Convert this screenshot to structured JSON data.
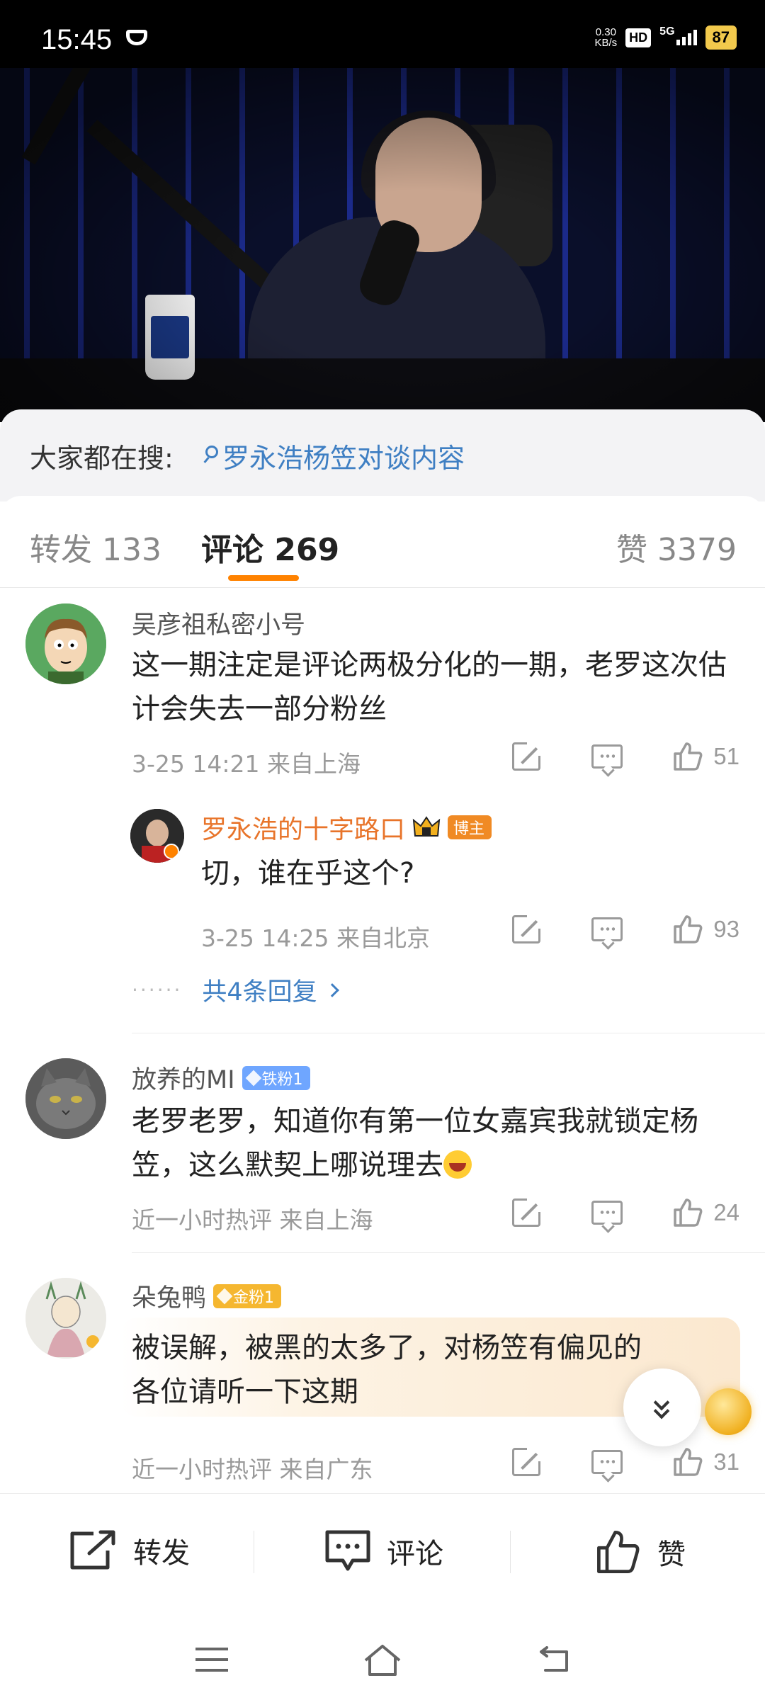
{
  "status_bar": {
    "time": "15:45",
    "net_speed_value": "0.30",
    "net_speed_unit": "KB/s",
    "hd": "HD",
    "network": "5G",
    "battery": "87"
  },
  "search_hint": {
    "label": "大家都在搜:",
    "query": "罗永浩杨笠对谈内容"
  },
  "tabs": {
    "repost_label": "转发",
    "repost_count": "133",
    "comment_label": "评论",
    "comment_count": "269",
    "like_label": "赞",
    "like_count": "3379"
  },
  "comments": [
    {
      "username": "吴彦祖私密小号",
      "text": "这一期注定是评论两极分化的一期，老罗这次估计会失去一部分粉丝",
      "meta": "3-25 14:21  来自上海",
      "likes": "51",
      "reply": {
        "username": "罗永浩的十字路口",
        "badge": "博主",
        "text": "切，谁在乎这个?",
        "meta": "3-25 14:25  来自北京",
        "likes": "93"
      },
      "more_replies": "共4条回复"
    },
    {
      "username": "放养的MI",
      "badge": "铁粉1",
      "text": "老罗老罗，知道你有第一位女嘉宾我就锁定杨笠，这么默契上哪说理去",
      "meta": "近一小时热评  来自上海",
      "likes": "24"
    },
    {
      "username": "朵兔鸭",
      "badge": "金粉1",
      "text": "被误解，被黑的太多了，对杨笠有偏见的各位请听一下这期",
      "meta": "近一小时热评  来自广东",
      "likes": "31"
    }
  ],
  "bottom_bar": {
    "repost": "转发",
    "comment": "评论",
    "like": "赞"
  },
  "colors": {
    "accent": "#ff8200",
    "link": "#3f7fc3",
    "blogger_name": "#e8742a",
    "iron_fan_badge": "#6fa6ff",
    "gold_fan_badge": "#f5b730"
  }
}
